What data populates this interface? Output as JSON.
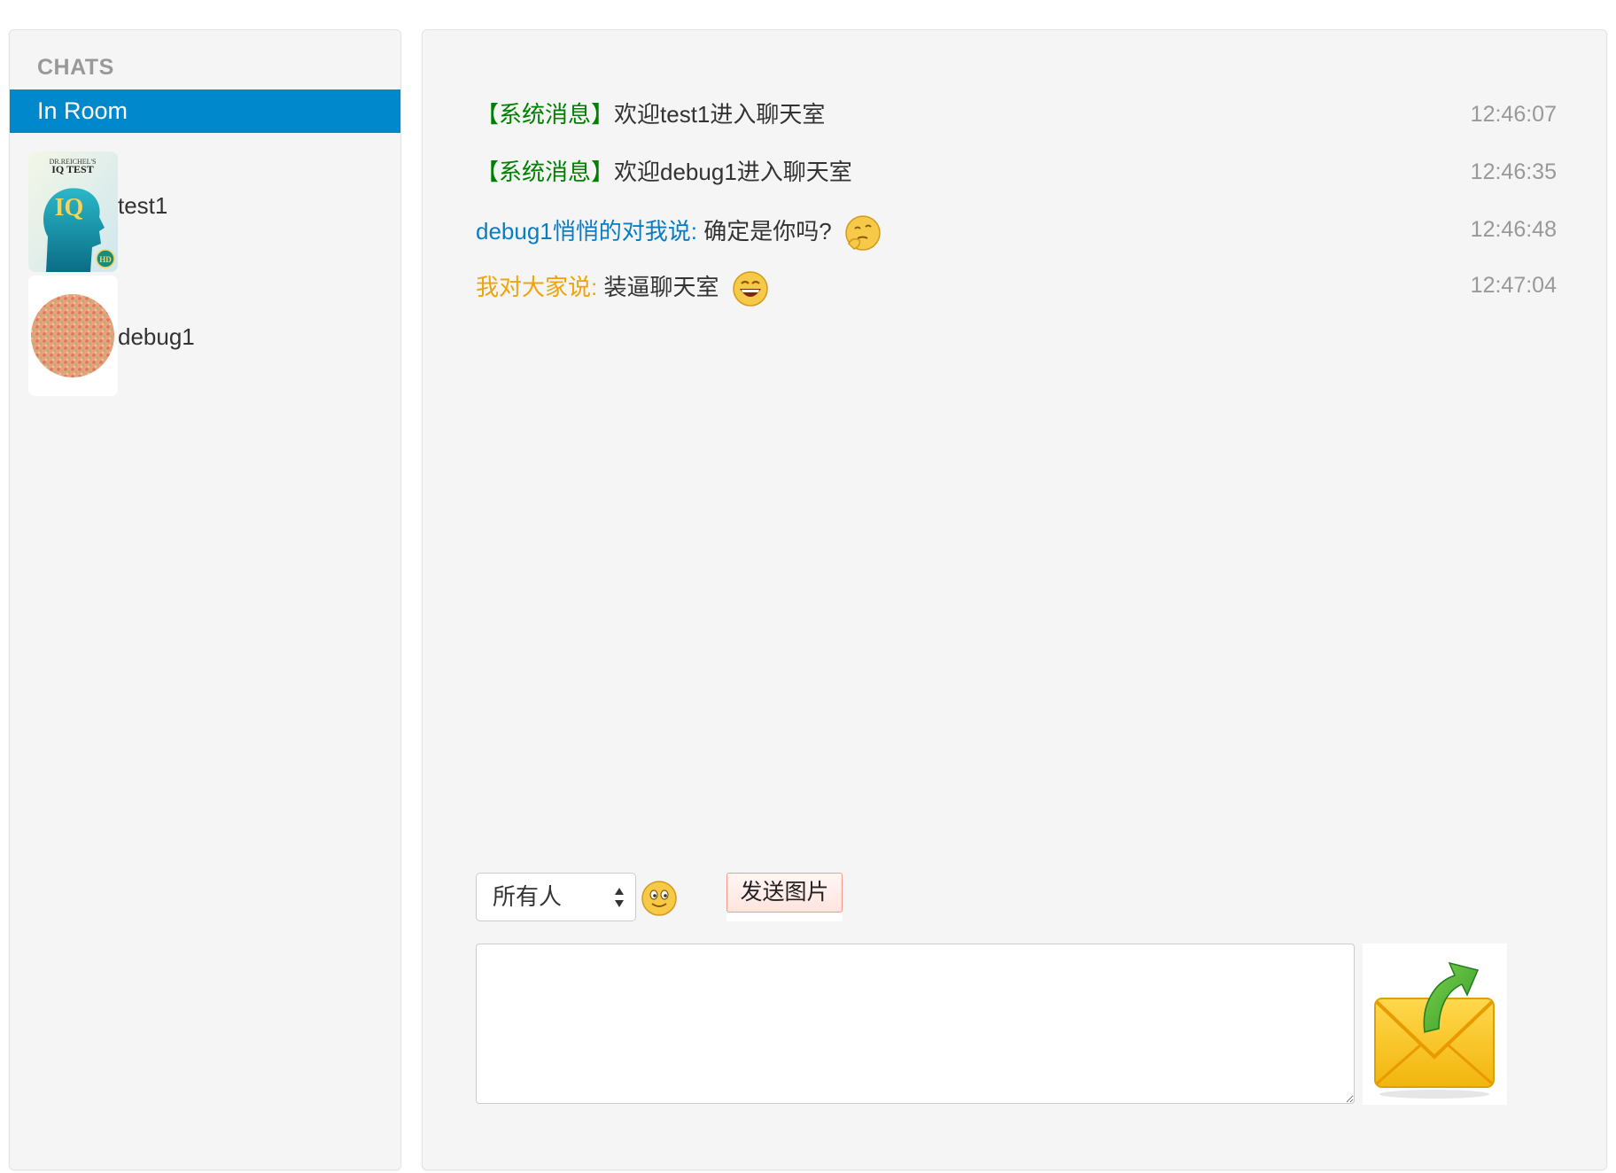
{
  "sidebar": {
    "header": "CHATS",
    "active_label": "In Room",
    "users": [
      {
        "name": "test1",
        "avatar_icon": "iq-test-avatar-icon",
        "avatar_text_top": "DR.REICHEL'S",
        "avatar_text_mid": "IQ TEST",
        "avatar_text_logo": "IQ",
        "avatar_text_badge": "HD"
      },
      {
        "name": "debug1",
        "avatar_icon": "color-blind-test-avatar-icon"
      }
    ]
  },
  "messages": [
    {
      "sender": "【系统消息】",
      "text": "欢迎test1进入聊天室",
      "time": "12:46:07",
      "sender_color": "#008000"
    },
    {
      "sender": "【系统消息】",
      "text": "欢迎debug1进入聊天室",
      "time": "12:46:35",
      "sender_color": "#008000"
    },
    {
      "sender": "debug1悄悄的对我说:",
      "text": " 确定是你吗?",
      "time": "12:46:48",
      "sender_color": "#0a7cc2",
      "emoji": "thinking-emoji-icon"
    },
    {
      "sender": "我对大家说:",
      "text": " 装逼聊天室",
      "time": "12:47:04",
      "sender_color": "#f0a30a",
      "emoji": "grin-emoji-icon"
    }
  ],
  "composer": {
    "recipient_selected": "所有人",
    "send_image_label": "发送图片",
    "message_placeholder": "",
    "emoji_picker_icon": "smiley-emoji-icon",
    "send_icon": "envelope-send-icon"
  },
  "colors": {
    "accent": "#0088cc",
    "system": "#008000",
    "whisper": "#0a7cc2",
    "broadcast": "#f0a30a"
  }
}
